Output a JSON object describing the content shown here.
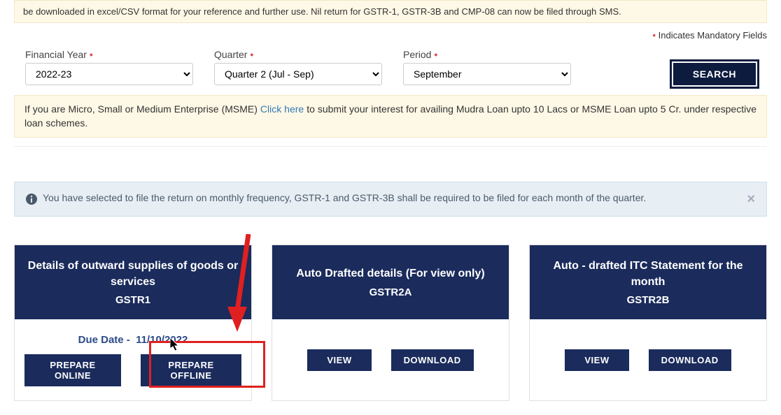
{
  "top_banner": "be downloaded in excel/CSV format for your reference and further use. Nil return for GSTR-1, GSTR-3B and CMP-08 can now be filed through SMS.",
  "mandatory_indicator": "Indicates Mandatory Fields",
  "filters": {
    "financial_year": {
      "label": "Financial Year",
      "value": "2022-23"
    },
    "quarter": {
      "label": "Quarter",
      "value": "Quarter 2 (Jul - Sep)"
    },
    "period": {
      "label": "Period",
      "value": "September"
    },
    "search_label": "SEARCH"
  },
  "msme": {
    "pre": "If you are Micro, Small or Medium Enterprise (MSME) ",
    "link": "Click here",
    "post": " to submit your interest for availing Mudra Loan upto 10 Lacs or MSME Loan upto 5 Cr. under respective loan schemes."
  },
  "info_alert": "You have selected to file the return on monthly frequency, GSTR-1 and GSTR-3B shall be required to be filed for each month of the quarter.",
  "cards": {
    "gstr1": {
      "title": "Details of outward supplies of goods or services",
      "subtitle": "GSTR1",
      "due_date_label": "Due Date - ",
      "due_date_value": "11/10/2022",
      "prepare_online": "PREPARE ONLINE",
      "prepare_offline": "PREPARE OFFLINE"
    },
    "gstr2a": {
      "title": "Auto Drafted details (For view only)",
      "subtitle": "GSTR2A",
      "view": "VIEW",
      "download": "DOWNLOAD"
    },
    "gstr2b": {
      "title": "Auto - drafted ITC Statement for the month",
      "subtitle": "GSTR2B",
      "view": "VIEW",
      "download": "DOWNLOAD"
    }
  }
}
